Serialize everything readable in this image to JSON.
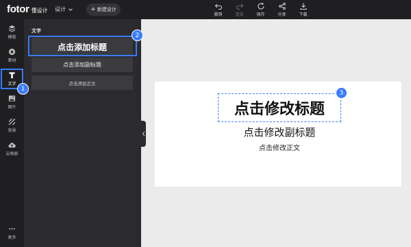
{
  "header": {
    "brand": "fotor",
    "brand_sub": "懂设计",
    "design_menu": "设计",
    "new_design": "新建设计",
    "tools": [
      {
        "label": "撤销",
        "icon": "undo-icon",
        "enabled": true
      },
      {
        "label": "重做",
        "icon": "redo-icon",
        "enabled": false
      },
      {
        "label": "保存",
        "icon": "save-icon",
        "enabled": true
      },
      {
        "label": "分享",
        "icon": "share-icon",
        "enabled": true
      },
      {
        "label": "下载",
        "icon": "download-icon",
        "enabled": true
      }
    ]
  },
  "sidebar": {
    "items": [
      {
        "label": "模版",
        "icon": "template-icon"
      },
      {
        "label": "素材",
        "icon": "elements-icon"
      },
      {
        "label": "文字",
        "icon": "text-icon",
        "active": true
      },
      {
        "label": "图片",
        "icon": "image-icon"
      },
      {
        "label": "背景",
        "icon": "background-icon"
      },
      {
        "label": "云相册",
        "icon": "cloud-album-icon"
      },
      {
        "label": "更多",
        "icon": "more-icon"
      }
    ]
  },
  "panel": {
    "title": "文字",
    "add_title": "点击添加标题",
    "add_subtitle": "点击添加副标题",
    "add_body": "点击添加正文"
  },
  "canvas": {
    "title": "点击修改标题",
    "subtitle": "点击修改副标题",
    "body": "点击修改正文"
  },
  "annotations": {
    "step1": "1",
    "step2": "2",
    "step3": "3",
    "color": "#3b7cff"
  }
}
